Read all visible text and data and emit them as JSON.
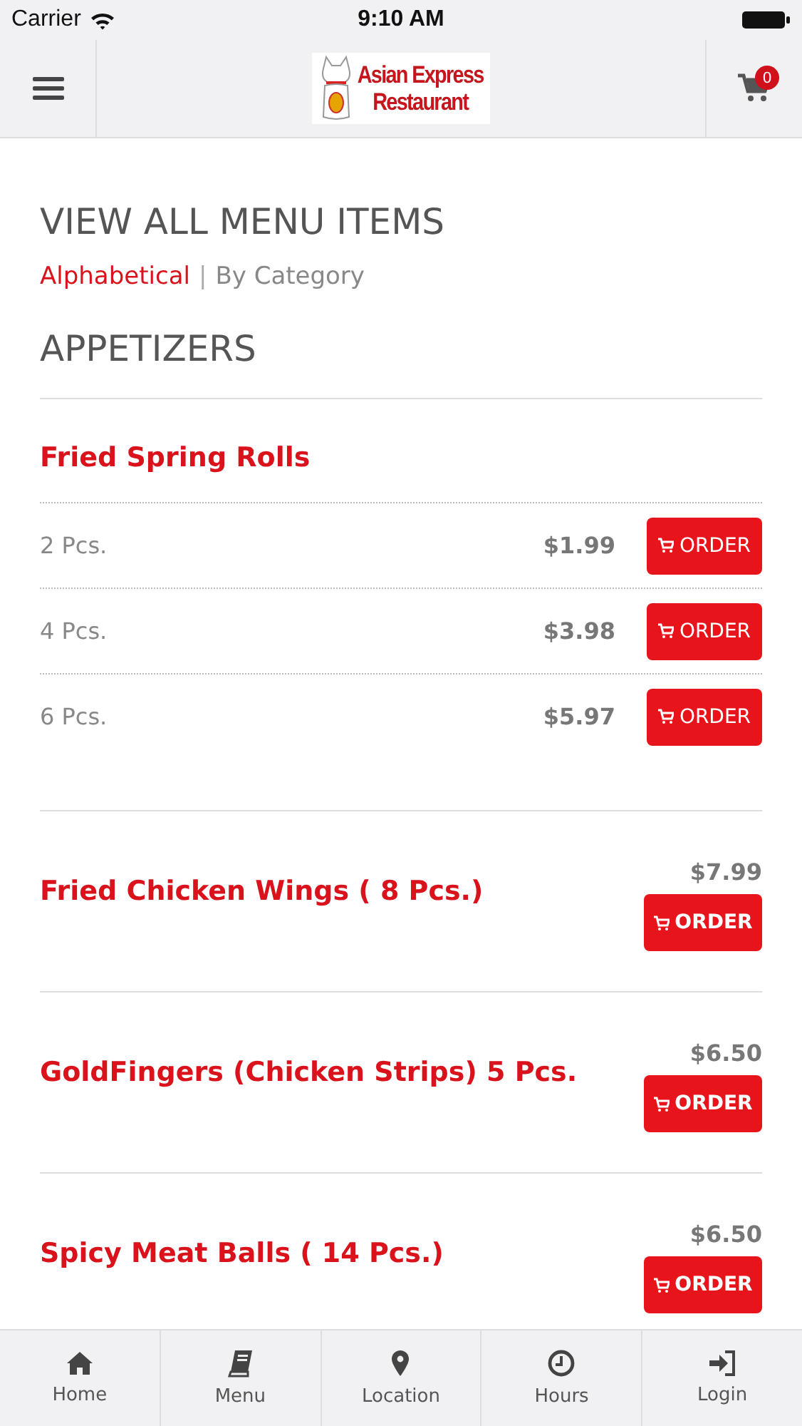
{
  "status_bar": {
    "carrier": "Carrier",
    "time": "9:10 AM"
  },
  "header": {
    "logo_lines": [
      "Asian Express",
      "Restaurant"
    ],
    "cart_count": "0"
  },
  "title": "VIEW ALL MENU ITEMS",
  "sort_options": [
    {
      "label": "Alphabetical",
      "selected": true
    },
    {
      "label": "By Category",
      "selected": false
    }
  ],
  "sort_separator": "|",
  "section": "APPETIZERS",
  "items": [
    {
      "kind": "variants",
      "name": "Fried Spring Rolls",
      "variants": [
        {
          "label": "2 Pcs.",
          "price": "$1.99",
          "button": "ORDER"
        },
        {
          "label": "4 Pcs.",
          "price": "$3.98",
          "button": "ORDER"
        },
        {
          "label": "6 Pcs.",
          "price": "$5.97",
          "button": "ORDER"
        }
      ]
    },
    {
      "kind": "single",
      "name": "Fried Chicken Wings ( 8 Pcs.)",
      "price": "$7.99",
      "button": "ORDER"
    },
    {
      "kind": "single",
      "name": "GoldFingers (Chicken Strips) 5 Pcs.",
      "price": "$6.50",
      "button": "ORDER"
    },
    {
      "kind": "single",
      "name": "Spicy Meat Balls ( 14 Pcs.)",
      "price": "$6.50",
      "button": "ORDER"
    }
  ],
  "nav": [
    {
      "label": "Home"
    },
    {
      "label": "Menu"
    },
    {
      "label": "Location"
    },
    {
      "label": "Hours"
    },
    {
      "label": "Login"
    }
  ]
}
